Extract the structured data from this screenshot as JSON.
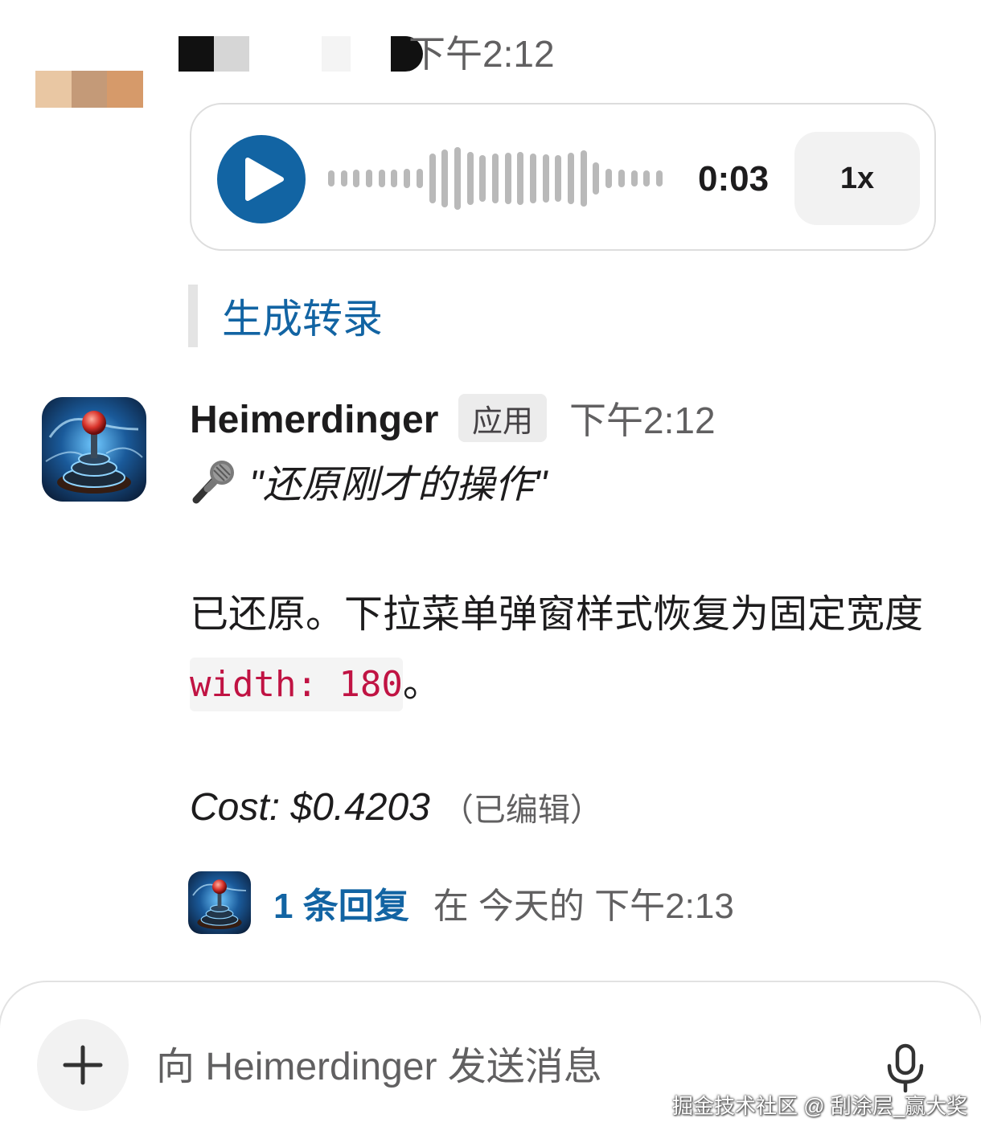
{
  "message_1": {
    "timestamp": "下午2:12",
    "audio": {
      "duration": "0:03",
      "playback_speed": "1x",
      "play_icon": "play-icon",
      "progress": 0
    },
    "transcript_link": "生成转录"
  },
  "message_2": {
    "sender": "Heimerdinger",
    "badge": "应用",
    "timestamp": "下午2:12",
    "voice_icon": "microphone-emoji-icon",
    "voice_quote": "\"还原刚才的操作\"",
    "body_prefix": "已还原。下拉菜单弹窗样式恢复为固定宽度 ",
    "body_code": "width: 180",
    "body_suffix": "。",
    "cost": "Cost: $0.4203",
    "edited": "（已编辑）",
    "replies": {
      "count_label": "1 条回复",
      "time_label": "在 今天的 下午2:13"
    }
  },
  "composer": {
    "placeholder": "向 Heimerdinger 发送消息",
    "plus_icon": "plus-icon",
    "mic_icon": "microphone-icon"
  },
  "watermark": "掘金技术社区 @ 刮涂层_赢大奖",
  "colors": {
    "link_blue": "#1264a3",
    "code_red": "#c01343",
    "muted_text": "#616061"
  }
}
